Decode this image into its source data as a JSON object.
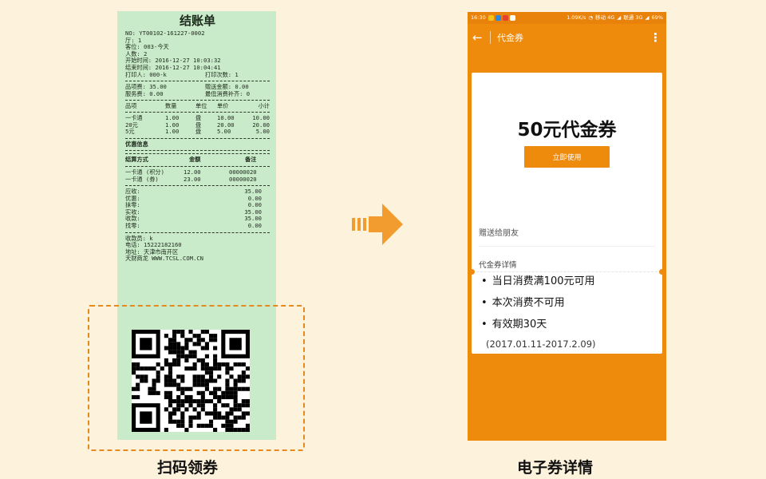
{
  "receipt": {
    "title": "结账单",
    "header_lines": [
      "NO: YT00102-161227-0002",
      "厅: 1",
      "客位: 003-今天",
      "人数: 2",
      "开始时间: 2016-12-27 10:03:32",
      "结束时间: 2016-12-27 10:04:41"
    ],
    "printer": {
      "left": "打印人: 000-k",
      "right": "打印次数: 1"
    },
    "fees": [
      {
        "left": "品项费: 35.00",
        "right": "赠送金额: 0.00"
      },
      {
        "left": "服务费: 0.00",
        "right": "最低消费补齐: 0"
      }
    ],
    "items_header": [
      "品项",
      "数量",
      "单位",
      "单价",
      "小计"
    ],
    "items": [
      [
        "一卡通",
        "1.00",
        "盘",
        "10.00",
        "10.00"
      ],
      [
        "20元",
        "1.00",
        "盘",
        "20.00",
        "20.00"
      ],
      [
        "5元",
        "1.00",
        "盘",
        "5.00",
        "5.00"
      ]
    ],
    "discount_label": "优惠信息",
    "settle_header": [
      "结算方式",
      "金额",
      "备注"
    ],
    "settle": [
      [
        "一卡通 (积分)",
        "12.00",
        "00000020"
      ],
      [
        "一卡通 (券)",
        "23.00",
        "00000020"
      ]
    ],
    "totals": [
      [
        "应收:",
        "35.00"
      ],
      [
        "优惠:",
        "0.00"
      ],
      [
        "抹零:",
        "0.00"
      ],
      [
        "实收:",
        "35.00"
      ],
      [
        "收款:",
        "35.00"
      ],
      [
        "找零:",
        "0.00"
      ]
    ],
    "footer_lines": [
      "收款员: k",
      "电话: 15222182160",
      "地址: 天津市南开区",
      "天财商龙 WWW.TCSL.COM.CN"
    ]
  },
  "caption_left": "扫码领券",
  "caption_right": "电子券详情",
  "phone": {
    "status": {
      "time": "16:30",
      "speed": "1.09K/s",
      "net1": "移动 4G",
      "net2": "联通 3G",
      "battery": "69%"
    },
    "appbar_title": "代金券",
    "voucher_title": "50元代金券",
    "use_button": "立即使用",
    "gift_label": "赠送给朋友",
    "details_title": "代金券详情",
    "details": [
      "当日消费满100元可用",
      "本次消费不可用",
      "有效期30天"
    ],
    "validity": "(2017.01.11-2017.2.09)"
  },
  "colors": {
    "accent": "#ee8a0c",
    "receipt_bg": "#c9ebc9",
    "page_bg": "#fdf2dc"
  }
}
